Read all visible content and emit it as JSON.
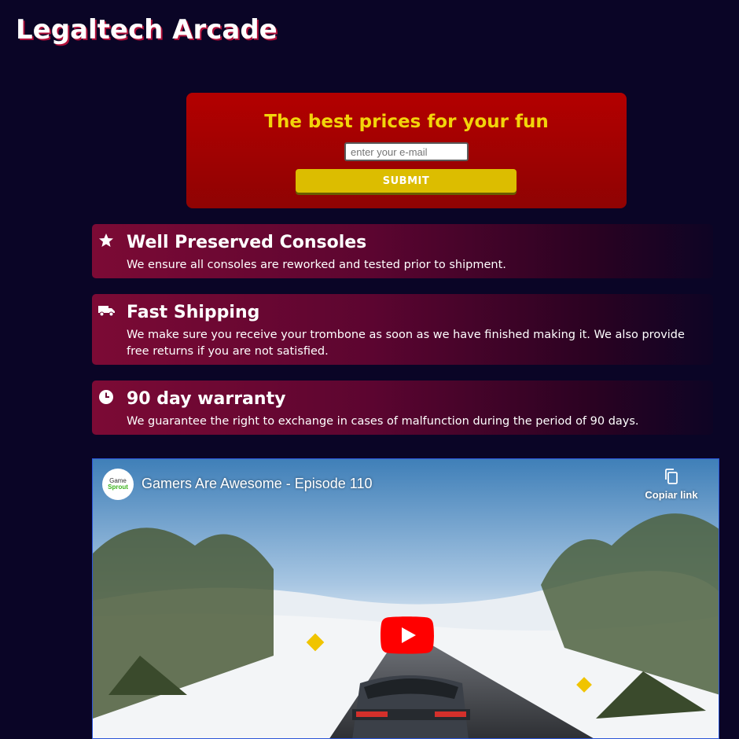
{
  "site": {
    "title": "Legaltech Arcade"
  },
  "signup": {
    "heading": "The best prices for your fun",
    "email_placeholder": "enter your e-mail",
    "submit_label": "SUBMIT"
  },
  "features": [
    {
      "icon": "star-icon",
      "title": "Well Preserved Consoles",
      "text": "We ensure all consoles are reworked and tested prior to shipment."
    },
    {
      "icon": "truck-icon",
      "title": "Fast Shipping",
      "text": "We make sure you receive your trombone as soon as we have finished making it. We also provide free returns if you are not satisfied."
    },
    {
      "icon": "clock-icon",
      "title": "90 day warranty",
      "text": "We guarantee the right to exchange in cases of malfunction during the period of 90 days."
    }
  ],
  "video": {
    "title": "Gamers Are Awesome - Episode 110",
    "channel_logo_text": [
      "Game",
      "Sprout"
    ],
    "copy_link_label": "Copiar link"
  },
  "colors": {
    "background": "#0a0526",
    "accent_red": "#b30000",
    "accent_yellow": "#dcbd00",
    "heading_yellow": "#f2d40a",
    "card_start": "#7c0a35"
  }
}
